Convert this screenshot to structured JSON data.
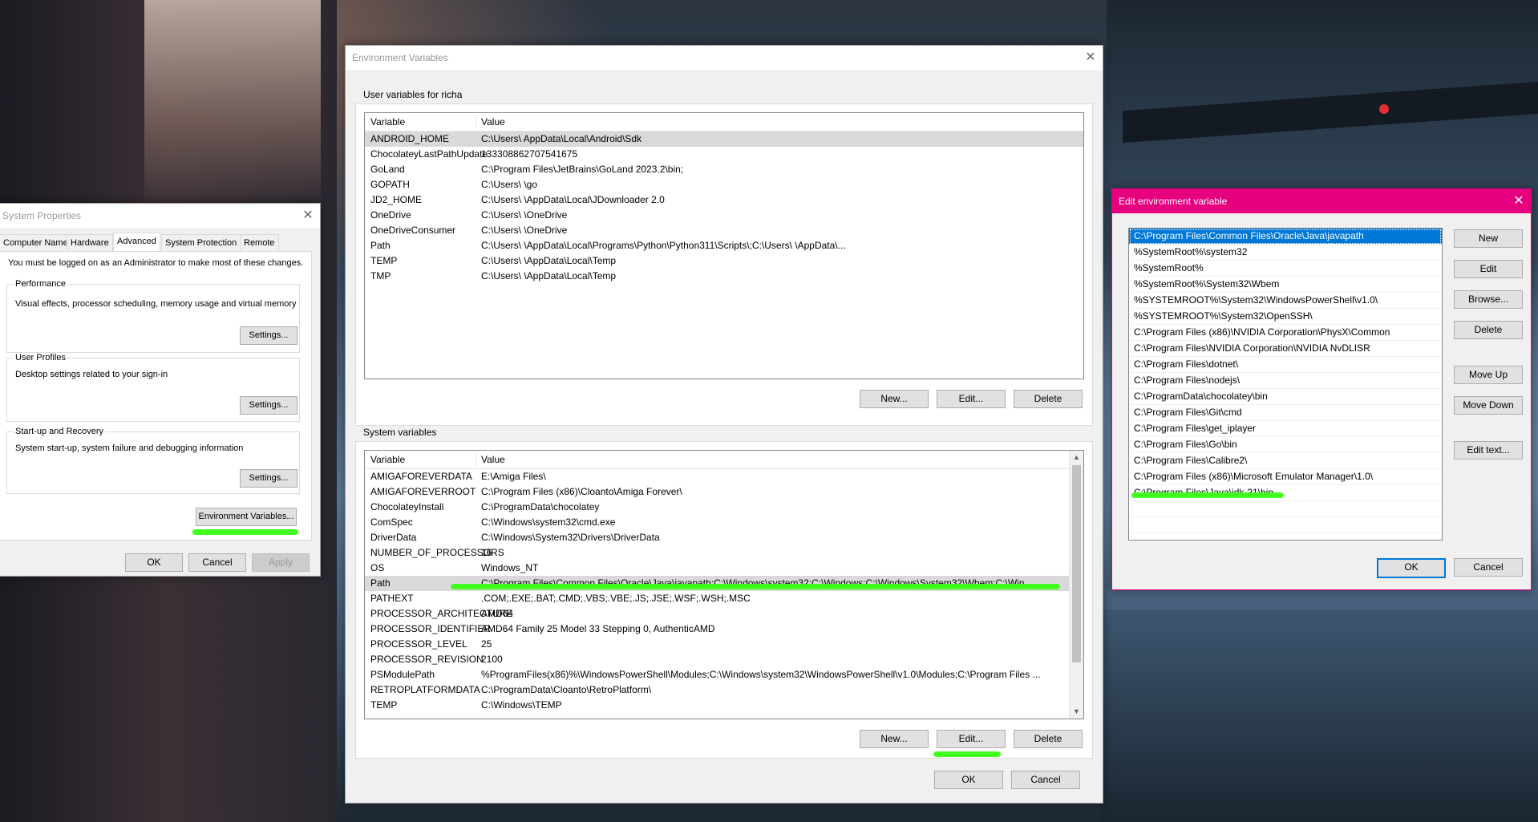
{
  "system_properties": {
    "title": "System Properties",
    "tabs": [
      "Computer Name",
      "Hardware",
      "Advanced",
      "System Protection",
      "Remote"
    ],
    "active_tab": "Advanced",
    "admin_note": "You must be logged on as an Administrator to make most of these changes.",
    "performance": {
      "title": "Performance",
      "desc": "Visual effects, processor scheduling, memory usage and virtual memory",
      "button": "Settings..."
    },
    "user_profiles": {
      "title": "User Profiles",
      "desc": "Desktop settings related to your sign-in",
      "button": "Settings..."
    },
    "startup": {
      "title": "Start-up and Recovery",
      "desc": "System start-up, system failure and debugging information",
      "button": "Settings..."
    },
    "env_button": "Environment Variables...",
    "ok": "OK",
    "cancel": "Cancel",
    "apply": "Apply"
  },
  "env_vars": {
    "title": "Environment Variables",
    "user_section": "User variables for richa",
    "col_variable": "Variable",
    "col_value": "Value",
    "user_vars": [
      {
        "name": "ANDROID_HOME",
        "value": "C:\\Users\\                                    AppData\\Local\\Android\\Sdk"
      },
      {
        "name": "ChocolateyLastPathUpdate",
        "value": "133308862707541675"
      },
      {
        "name": "GoLand",
        "value": "C:\\Program Files\\JetBrains\\GoLand 2023.2\\bin;"
      },
      {
        "name": "GOPATH",
        "value": "C:\\Users\\                                   \\go"
      },
      {
        "name": "JD2_HOME",
        "value": "C:\\Users\\                                   \\AppData\\Local\\JDownloader 2.0"
      },
      {
        "name": "OneDrive",
        "value": "C:\\Users\\                                   \\OneDrive"
      },
      {
        "name": "OneDriveConsumer",
        "value": "C:\\Users\\                                   \\OneDrive"
      },
      {
        "name": "Path",
        "value": "C:\\Users\\                                   \\AppData\\Local\\Programs\\Python\\Python311\\Scripts\\;C:\\Users\\                                                    \\AppData\\..."
      },
      {
        "name": "TEMP",
        "value": "C:\\Users\\                                   \\AppData\\Local\\Temp"
      },
      {
        "name": "TMP",
        "value": "C:\\Users\\                                   \\AppData\\Local\\Temp"
      }
    ],
    "user_buttons": {
      "new": "New...",
      "edit": "Edit...",
      "delete": "Delete"
    },
    "system_section": "System variables",
    "system_vars": [
      {
        "name": "AMIGAFOREVERDATA",
        "value": "E:\\Amiga Files\\"
      },
      {
        "name": "AMIGAFOREVERROOT",
        "value": "C:\\Program Files (x86)\\Cloanto\\Amiga Forever\\"
      },
      {
        "name": "ChocolateyInstall",
        "value": "C:\\ProgramData\\chocolatey"
      },
      {
        "name": "ComSpec",
        "value": "C:\\Windows\\system32\\cmd.exe"
      },
      {
        "name": "DriverData",
        "value": "C:\\Windows\\System32\\Drivers\\DriverData"
      },
      {
        "name": "NUMBER_OF_PROCESSORS",
        "value": "16"
      },
      {
        "name": "OS",
        "value": "Windows_NT"
      },
      {
        "name": "Path",
        "value": "C:\\Program Files\\Common Files\\Oracle\\Java\\javapath;C:\\Windows\\system32;C:\\Windows;C:\\Windows\\System32\\Wbem;C:\\Win..."
      },
      {
        "name": "PATHEXT",
        "value": ".COM;.EXE;.BAT;.CMD;.VBS;.VBE;.JS;.JSE;.WSF;.WSH;.MSC"
      },
      {
        "name": "PROCESSOR_ARCHITECTURE",
        "value": "AMD64"
      },
      {
        "name": "PROCESSOR_IDENTIFIER",
        "value": "AMD64 Family 25 Model 33 Stepping 0, AuthenticAMD"
      },
      {
        "name": "PROCESSOR_LEVEL",
        "value": "25"
      },
      {
        "name": "PROCESSOR_REVISION",
        "value": "2100"
      },
      {
        "name": "PSModulePath",
        "value": "%ProgramFiles(x86)%\\WindowsPowerShell\\Modules;C:\\Windows\\system32\\WindowsPowerShell\\v1.0\\Modules;C:\\Program Files ..."
      },
      {
        "name": "RETROPLATFORMDATA",
        "value": "C:\\ProgramData\\Cloanto\\RetroPlatform\\"
      },
      {
        "name": "TEMP",
        "value": "C:\\Windows\\TEMP"
      }
    ],
    "system_buttons": {
      "new": "New...",
      "edit": "Edit...",
      "delete": "Delete"
    },
    "ok": "OK",
    "cancel": "Cancel"
  },
  "edit_env": {
    "title": "Edit environment variable",
    "entries": [
      "C:\\Program Files\\Common Files\\Oracle\\Java\\javapath",
      "%SystemRoot%\\system32",
      "%SystemRoot%",
      "%SystemRoot%\\System32\\Wbem",
      "%SYSTEMROOT%\\System32\\WindowsPowerShell\\v1.0\\",
      "%SYSTEMROOT%\\System32\\OpenSSH\\",
      "C:\\Program Files (x86)\\NVIDIA Corporation\\PhysX\\Common",
      "C:\\Program Files\\NVIDIA Corporation\\NVIDIA NvDLISR",
      "C:\\Program Files\\dotnet\\",
      "C:\\Program Files\\nodejs\\",
      "C:\\ProgramData\\chocolatey\\bin",
      "C:\\Program Files\\Git\\cmd",
      "C:\\Program Files\\get_iplayer",
      "C:\\Program Files\\Go\\bin",
      "C:\\Program Files\\Calibre2\\",
      "C:\\Program Files (x86)\\Microsoft Emulator Manager\\1.0\\",
      "C:\\Program Files\\Java\\jdk-21\\bin"
    ],
    "buttons": {
      "new": "New",
      "edit": "Edit",
      "browse": "Browse...",
      "delete": "Delete",
      "move_up": "Move Up",
      "move_down": "Move Down",
      "edit_text": "Edit text..."
    },
    "ok": "OK",
    "cancel": "Cancel"
  },
  "colors": {
    "accent": "#0078d7",
    "titlebar_pink": "#e6007e",
    "highlight_green": "#39ff14"
  },
  "icons": {
    "close": "close-icon",
    "scroll_up": "chevron-up-icon",
    "scroll_down": "chevron-down-icon"
  }
}
